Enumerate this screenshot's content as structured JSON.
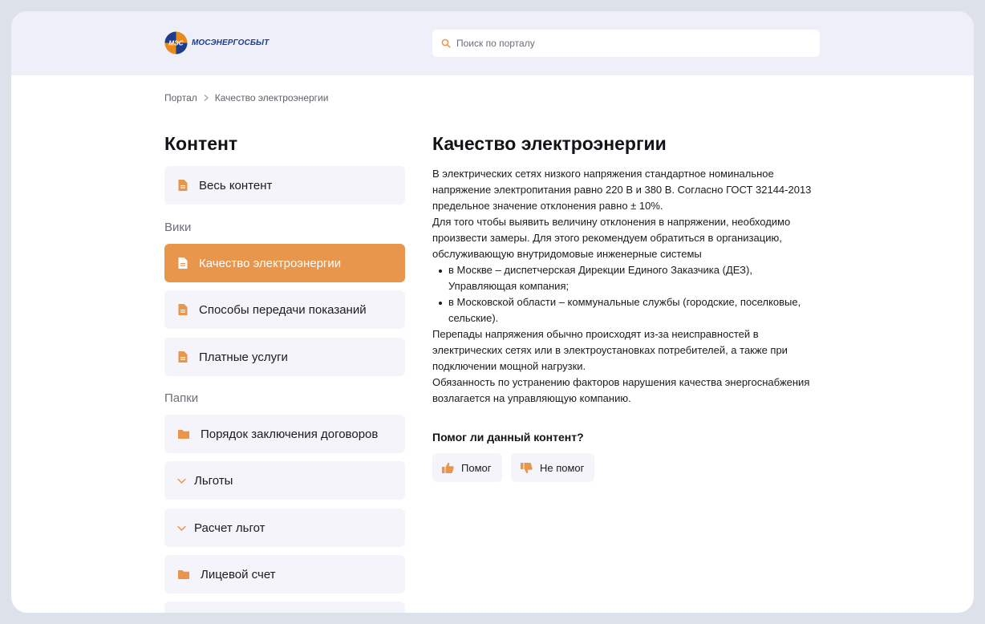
{
  "header": {
    "logo_text": "МОСЭНЕРГОСБЫТ",
    "logo_mark_text": "МЭС",
    "search_placeholder": "Поиск по порталу"
  },
  "breadcrumb": {
    "root": "Портал",
    "current": "Качество электроэнергии"
  },
  "sidebar": {
    "title": "Контент",
    "all_content": "Весь контент",
    "wiki_label": "Вики",
    "wiki_items": [
      {
        "label": "Качество электроэнергии",
        "active": true
      },
      {
        "label": "Способы передачи показаний",
        "active": false
      },
      {
        "label": "Платные услуги",
        "active": false
      }
    ],
    "folders_label": "Папки",
    "folder_items": [
      {
        "label": "Порядок заключения договоров",
        "icon": "folder-icon"
      },
      {
        "label": "Льготы",
        "icon": "chevron-down-icon"
      },
      {
        "label": "Расчет льгот",
        "icon": "chevron-down-icon"
      },
      {
        "label": "Лицевой счет",
        "icon": "folder-icon"
      }
    ]
  },
  "article": {
    "title": "Качество электроэнергии",
    "p1": "В электрических сетях низкого напряжения стандартное номинальное напряжение электропитания равно 220 В и 380 В. Согласно ГОСТ 32144-2013 предельное значение отклонения равно ± 10%.",
    "p2": "Для того чтобы выявить величину отклонения в напряжении, необходимо произвести замеры. Для этого рекомендуем обратиться в организацию, обслуживающую внутридомовые инженерные системы",
    "bullets": [
      "в Москве – диспетчерская Дирекции Единого Заказчика (ДЕЗ), Управляющая компания;",
      "в Московской области – коммунальные службы (городские, поселковые, сельские)."
    ],
    "p3": "Перепады напряжения обычно происходят из-за неисправностей в электрических сетях или в электроустановках потребителей, а также при подключении мощной нагрузки.",
    "p4": "Обязанность по устранению факторов нарушения качества энергоснабжения возлагается на управляющую компанию."
  },
  "feedback": {
    "question": "Помог ли данный контент?",
    "yes": "Помог",
    "no": "Не помог"
  },
  "colors": {
    "accent": "#e8964c",
    "header_bg": "#eeeff8",
    "item_bg": "#f4f4fa",
    "logo_blue": "#1f3c8c"
  }
}
